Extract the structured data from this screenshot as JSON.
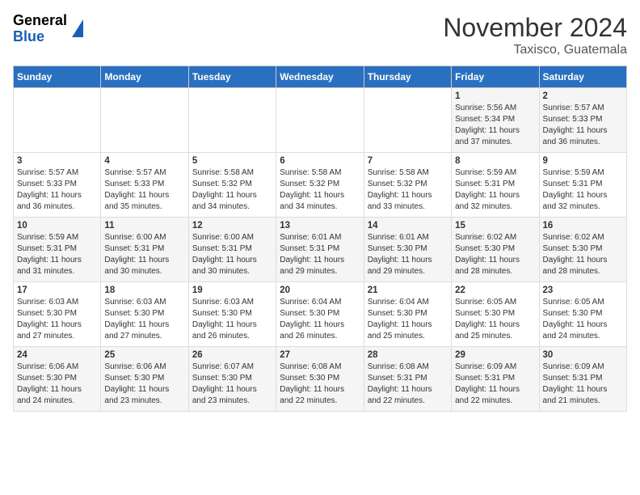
{
  "header": {
    "logo_line1": "General",
    "logo_line2": "Blue",
    "title": "November 2024",
    "subtitle": "Taxisco, Guatemala"
  },
  "weekdays": [
    "Sunday",
    "Monday",
    "Tuesday",
    "Wednesday",
    "Thursday",
    "Friday",
    "Saturday"
  ],
  "weeks": [
    [
      {
        "day": "",
        "info": ""
      },
      {
        "day": "",
        "info": ""
      },
      {
        "day": "",
        "info": ""
      },
      {
        "day": "",
        "info": ""
      },
      {
        "day": "",
        "info": ""
      },
      {
        "day": "1",
        "info": "Sunrise: 5:56 AM\nSunset: 5:34 PM\nDaylight: 11 hours\nand 37 minutes."
      },
      {
        "day": "2",
        "info": "Sunrise: 5:57 AM\nSunset: 5:33 PM\nDaylight: 11 hours\nand 36 minutes."
      }
    ],
    [
      {
        "day": "3",
        "info": "Sunrise: 5:57 AM\nSunset: 5:33 PM\nDaylight: 11 hours\nand 36 minutes."
      },
      {
        "day": "4",
        "info": "Sunrise: 5:57 AM\nSunset: 5:33 PM\nDaylight: 11 hours\nand 35 minutes."
      },
      {
        "day": "5",
        "info": "Sunrise: 5:58 AM\nSunset: 5:32 PM\nDaylight: 11 hours\nand 34 minutes."
      },
      {
        "day": "6",
        "info": "Sunrise: 5:58 AM\nSunset: 5:32 PM\nDaylight: 11 hours\nand 34 minutes."
      },
      {
        "day": "7",
        "info": "Sunrise: 5:58 AM\nSunset: 5:32 PM\nDaylight: 11 hours\nand 33 minutes."
      },
      {
        "day": "8",
        "info": "Sunrise: 5:59 AM\nSunset: 5:31 PM\nDaylight: 11 hours\nand 32 minutes."
      },
      {
        "day": "9",
        "info": "Sunrise: 5:59 AM\nSunset: 5:31 PM\nDaylight: 11 hours\nand 32 minutes."
      }
    ],
    [
      {
        "day": "10",
        "info": "Sunrise: 5:59 AM\nSunset: 5:31 PM\nDaylight: 11 hours\nand 31 minutes."
      },
      {
        "day": "11",
        "info": "Sunrise: 6:00 AM\nSunset: 5:31 PM\nDaylight: 11 hours\nand 30 minutes."
      },
      {
        "day": "12",
        "info": "Sunrise: 6:00 AM\nSunset: 5:31 PM\nDaylight: 11 hours\nand 30 minutes."
      },
      {
        "day": "13",
        "info": "Sunrise: 6:01 AM\nSunset: 5:31 PM\nDaylight: 11 hours\nand 29 minutes."
      },
      {
        "day": "14",
        "info": "Sunrise: 6:01 AM\nSunset: 5:30 PM\nDaylight: 11 hours\nand 29 minutes."
      },
      {
        "day": "15",
        "info": "Sunrise: 6:02 AM\nSunset: 5:30 PM\nDaylight: 11 hours\nand 28 minutes."
      },
      {
        "day": "16",
        "info": "Sunrise: 6:02 AM\nSunset: 5:30 PM\nDaylight: 11 hours\nand 28 minutes."
      }
    ],
    [
      {
        "day": "17",
        "info": "Sunrise: 6:03 AM\nSunset: 5:30 PM\nDaylight: 11 hours\nand 27 minutes."
      },
      {
        "day": "18",
        "info": "Sunrise: 6:03 AM\nSunset: 5:30 PM\nDaylight: 11 hours\nand 27 minutes."
      },
      {
        "day": "19",
        "info": "Sunrise: 6:03 AM\nSunset: 5:30 PM\nDaylight: 11 hours\nand 26 minutes."
      },
      {
        "day": "20",
        "info": "Sunrise: 6:04 AM\nSunset: 5:30 PM\nDaylight: 11 hours\nand 26 minutes."
      },
      {
        "day": "21",
        "info": "Sunrise: 6:04 AM\nSunset: 5:30 PM\nDaylight: 11 hours\nand 25 minutes."
      },
      {
        "day": "22",
        "info": "Sunrise: 6:05 AM\nSunset: 5:30 PM\nDaylight: 11 hours\nand 25 minutes."
      },
      {
        "day": "23",
        "info": "Sunrise: 6:05 AM\nSunset: 5:30 PM\nDaylight: 11 hours\nand 24 minutes."
      }
    ],
    [
      {
        "day": "24",
        "info": "Sunrise: 6:06 AM\nSunset: 5:30 PM\nDaylight: 11 hours\nand 24 minutes."
      },
      {
        "day": "25",
        "info": "Sunrise: 6:06 AM\nSunset: 5:30 PM\nDaylight: 11 hours\nand 23 minutes."
      },
      {
        "day": "26",
        "info": "Sunrise: 6:07 AM\nSunset: 5:30 PM\nDaylight: 11 hours\nand 23 minutes."
      },
      {
        "day": "27",
        "info": "Sunrise: 6:08 AM\nSunset: 5:30 PM\nDaylight: 11 hours\nand 22 minutes."
      },
      {
        "day": "28",
        "info": "Sunrise: 6:08 AM\nSunset: 5:31 PM\nDaylight: 11 hours\nand 22 minutes."
      },
      {
        "day": "29",
        "info": "Sunrise: 6:09 AM\nSunset: 5:31 PM\nDaylight: 11 hours\nand 22 minutes."
      },
      {
        "day": "30",
        "info": "Sunrise: 6:09 AM\nSunset: 5:31 PM\nDaylight: 11 hours\nand 21 minutes."
      }
    ]
  ]
}
